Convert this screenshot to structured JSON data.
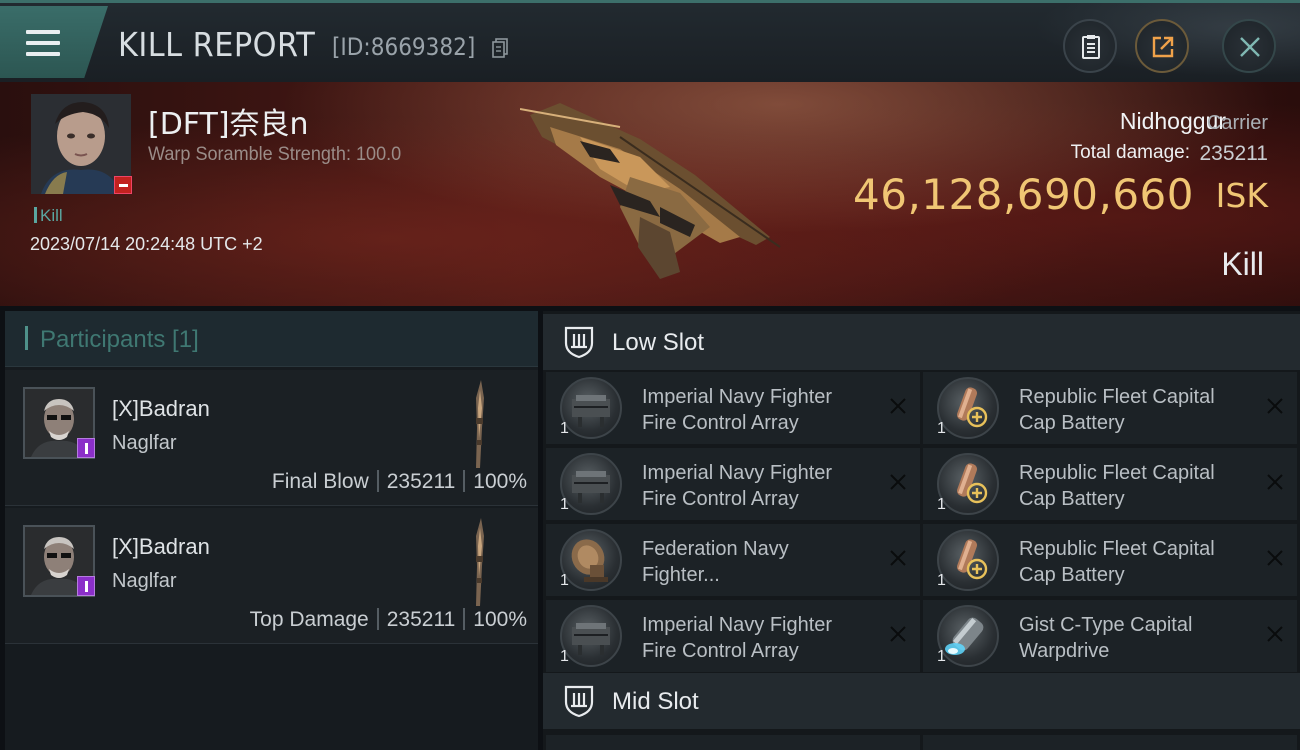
{
  "header": {
    "title": "KILL REPORT",
    "report_id": "[ID:8669382]"
  },
  "victim": {
    "name": "[DFT]奈良n",
    "warp_scramble": "Warp Soramble Strength: 100.0",
    "tag": "Kill",
    "datetime": "2023/07/14 20:24:48 UTC +2",
    "ship_name": "Nidhoggur",
    "ship_class": "Carrier",
    "total_damage_label": "Total damage:",
    "total_damage": "235211",
    "isk_value": "46,128,690,660",
    "isk_unit": "ISK",
    "result": "Kill"
  },
  "participants": {
    "header": "Participants [1]",
    "rows": [
      {
        "name": "[X]Badran",
        "ship": "Naglfar",
        "role": "Final Blow",
        "damage": "235211",
        "percent": "100%"
      },
      {
        "name": "[X]Badran",
        "ship": "Naglfar",
        "role": "Top Damage",
        "damage": "235211",
        "percent": "100%"
      }
    ]
  },
  "low_slot": {
    "title": "Low Slot",
    "modules": [
      {
        "qty": "1",
        "name": "Imperial Navy Fighter Fire Control Array",
        "icon": "fire-control-array-icon"
      },
      {
        "qty": "1",
        "name": "Republic Fleet Capital Cap Battery",
        "icon": "cap-battery-icon"
      },
      {
        "qty": "1",
        "name": "Imperial Navy Fighter Fire Control Array",
        "icon": "fire-control-array-icon"
      },
      {
        "qty": "1",
        "name": "Republic Fleet Capital Cap Battery",
        "icon": "cap-battery-icon"
      },
      {
        "qty": "1",
        "name": "Federation Navy Fighter...",
        "icon": "dish-icon"
      },
      {
        "qty": "1",
        "name": "Republic Fleet Capital Cap Battery",
        "icon": "cap-battery-icon"
      },
      {
        "qty": "1",
        "name": "Imperial Navy Fighter Fire Control Array",
        "icon": "fire-control-array-icon"
      },
      {
        "qty": "1",
        "name": "Gist C-Type Capital Warpdrive",
        "icon": "warpdrive-icon"
      }
    ]
  },
  "mid_slot": {
    "title": "Mid Slot"
  },
  "colors": {
    "accent_teal": "#3c6f6a",
    "isk_gold": "#f0c674",
    "loss_red": "#c2221f",
    "badge_purple": "#8b2fc9"
  }
}
